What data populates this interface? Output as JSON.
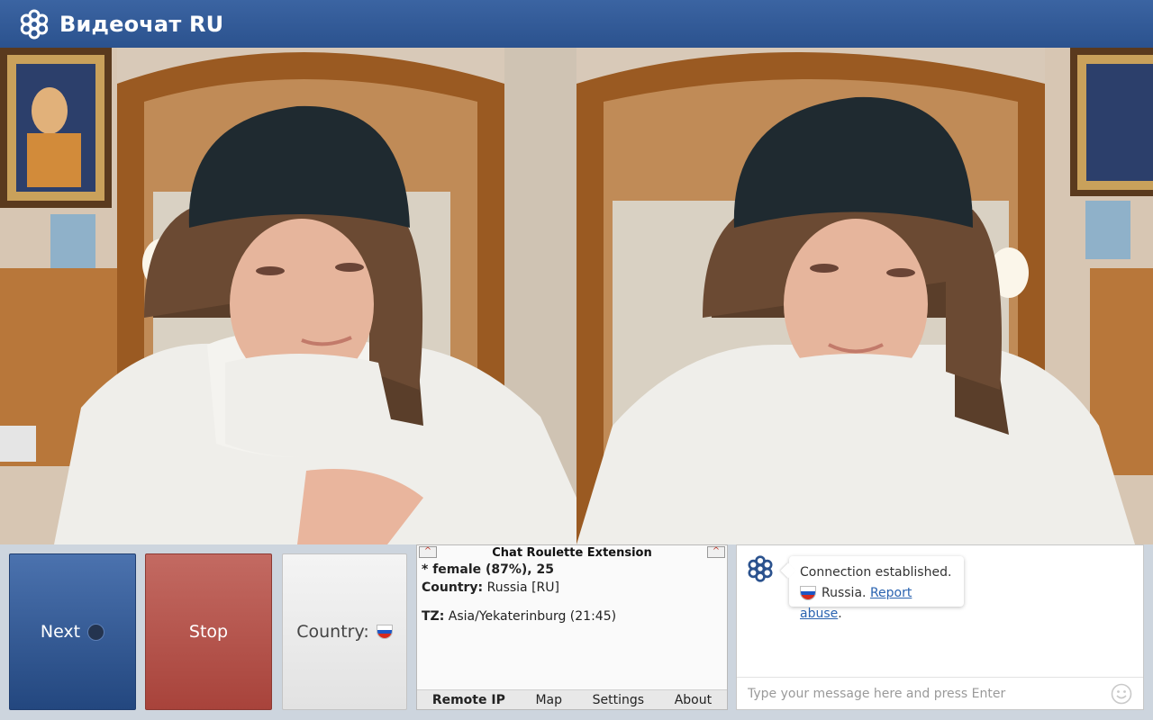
{
  "header": {
    "title": "Видеочат RU",
    "logo_icon": "flower-logo-icon"
  },
  "videos": {
    "left": {
      "name": "remote-video-feed"
    },
    "right": {
      "name": "local-video-feed"
    }
  },
  "controls": {
    "next_label": "Next",
    "stop_label": "Stop",
    "country_label": "Country:",
    "country_flag": "russia-flag-icon"
  },
  "extension": {
    "title": "Chat Roulette Extension",
    "gender_line": "* female (87%), 25",
    "country_key": "Country:",
    "country_value": "Russia [RU]",
    "tz_key": "TZ:",
    "tz_value": "Asia/Yekaterinburg (21:45)",
    "tabs": [
      {
        "label": "Remote IP"
      },
      {
        "label": "Map"
      },
      {
        "label": "Settings"
      },
      {
        "label": "About"
      }
    ]
  },
  "chat": {
    "status": "Connection established.",
    "country": "Russia",
    "report_link": "Report abuse",
    "input_placeholder": "Type your message here and press Enter"
  },
  "colors": {
    "header": "#2f5793",
    "next": "#2e5290",
    "stop": "#b4514a",
    "link": "#2a63b0"
  }
}
